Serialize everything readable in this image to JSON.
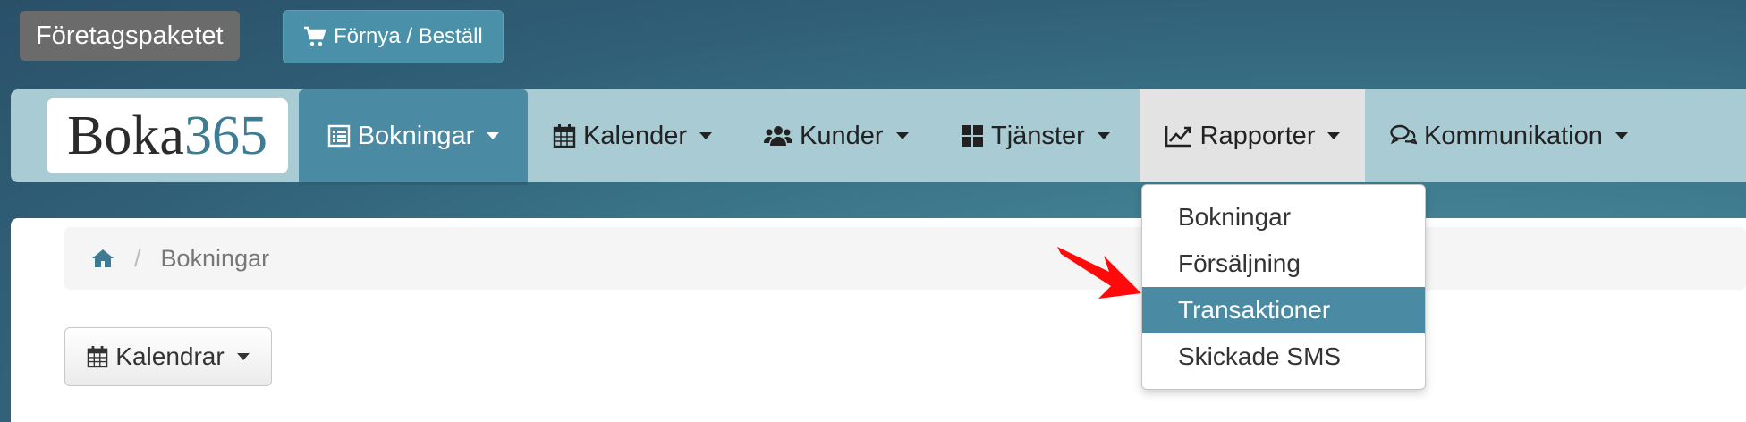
{
  "topbar": {
    "package_label": "Företagspaketet",
    "renew_label": "Förnya / Beställ"
  },
  "logo": {
    "text_main": "Boka",
    "text_num": "365"
  },
  "nav": {
    "items": [
      {
        "label": "Bokningar",
        "icon": "list-icon"
      },
      {
        "label": "Kalender",
        "icon": "calendar-icon"
      },
      {
        "label": "Kunder",
        "icon": "users-icon"
      },
      {
        "label": "Tjänster",
        "icon": "grid-icon"
      },
      {
        "label": "Rapporter",
        "icon": "chart-line-icon"
      },
      {
        "label": "Kommunikation",
        "icon": "comments-icon"
      }
    ]
  },
  "dropdown": {
    "items": [
      "Bokningar",
      "Försäljning",
      "Transaktioner",
      "Skickade SMS"
    ],
    "active": "Transaktioner"
  },
  "breadcrumb": {
    "current": "Bokningar"
  },
  "calendars_button": {
    "label": "Kalendrar"
  },
  "colors": {
    "accent": "#4a8aa3",
    "navbar": "#a9cbd3",
    "arrow": "#ff0000"
  }
}
